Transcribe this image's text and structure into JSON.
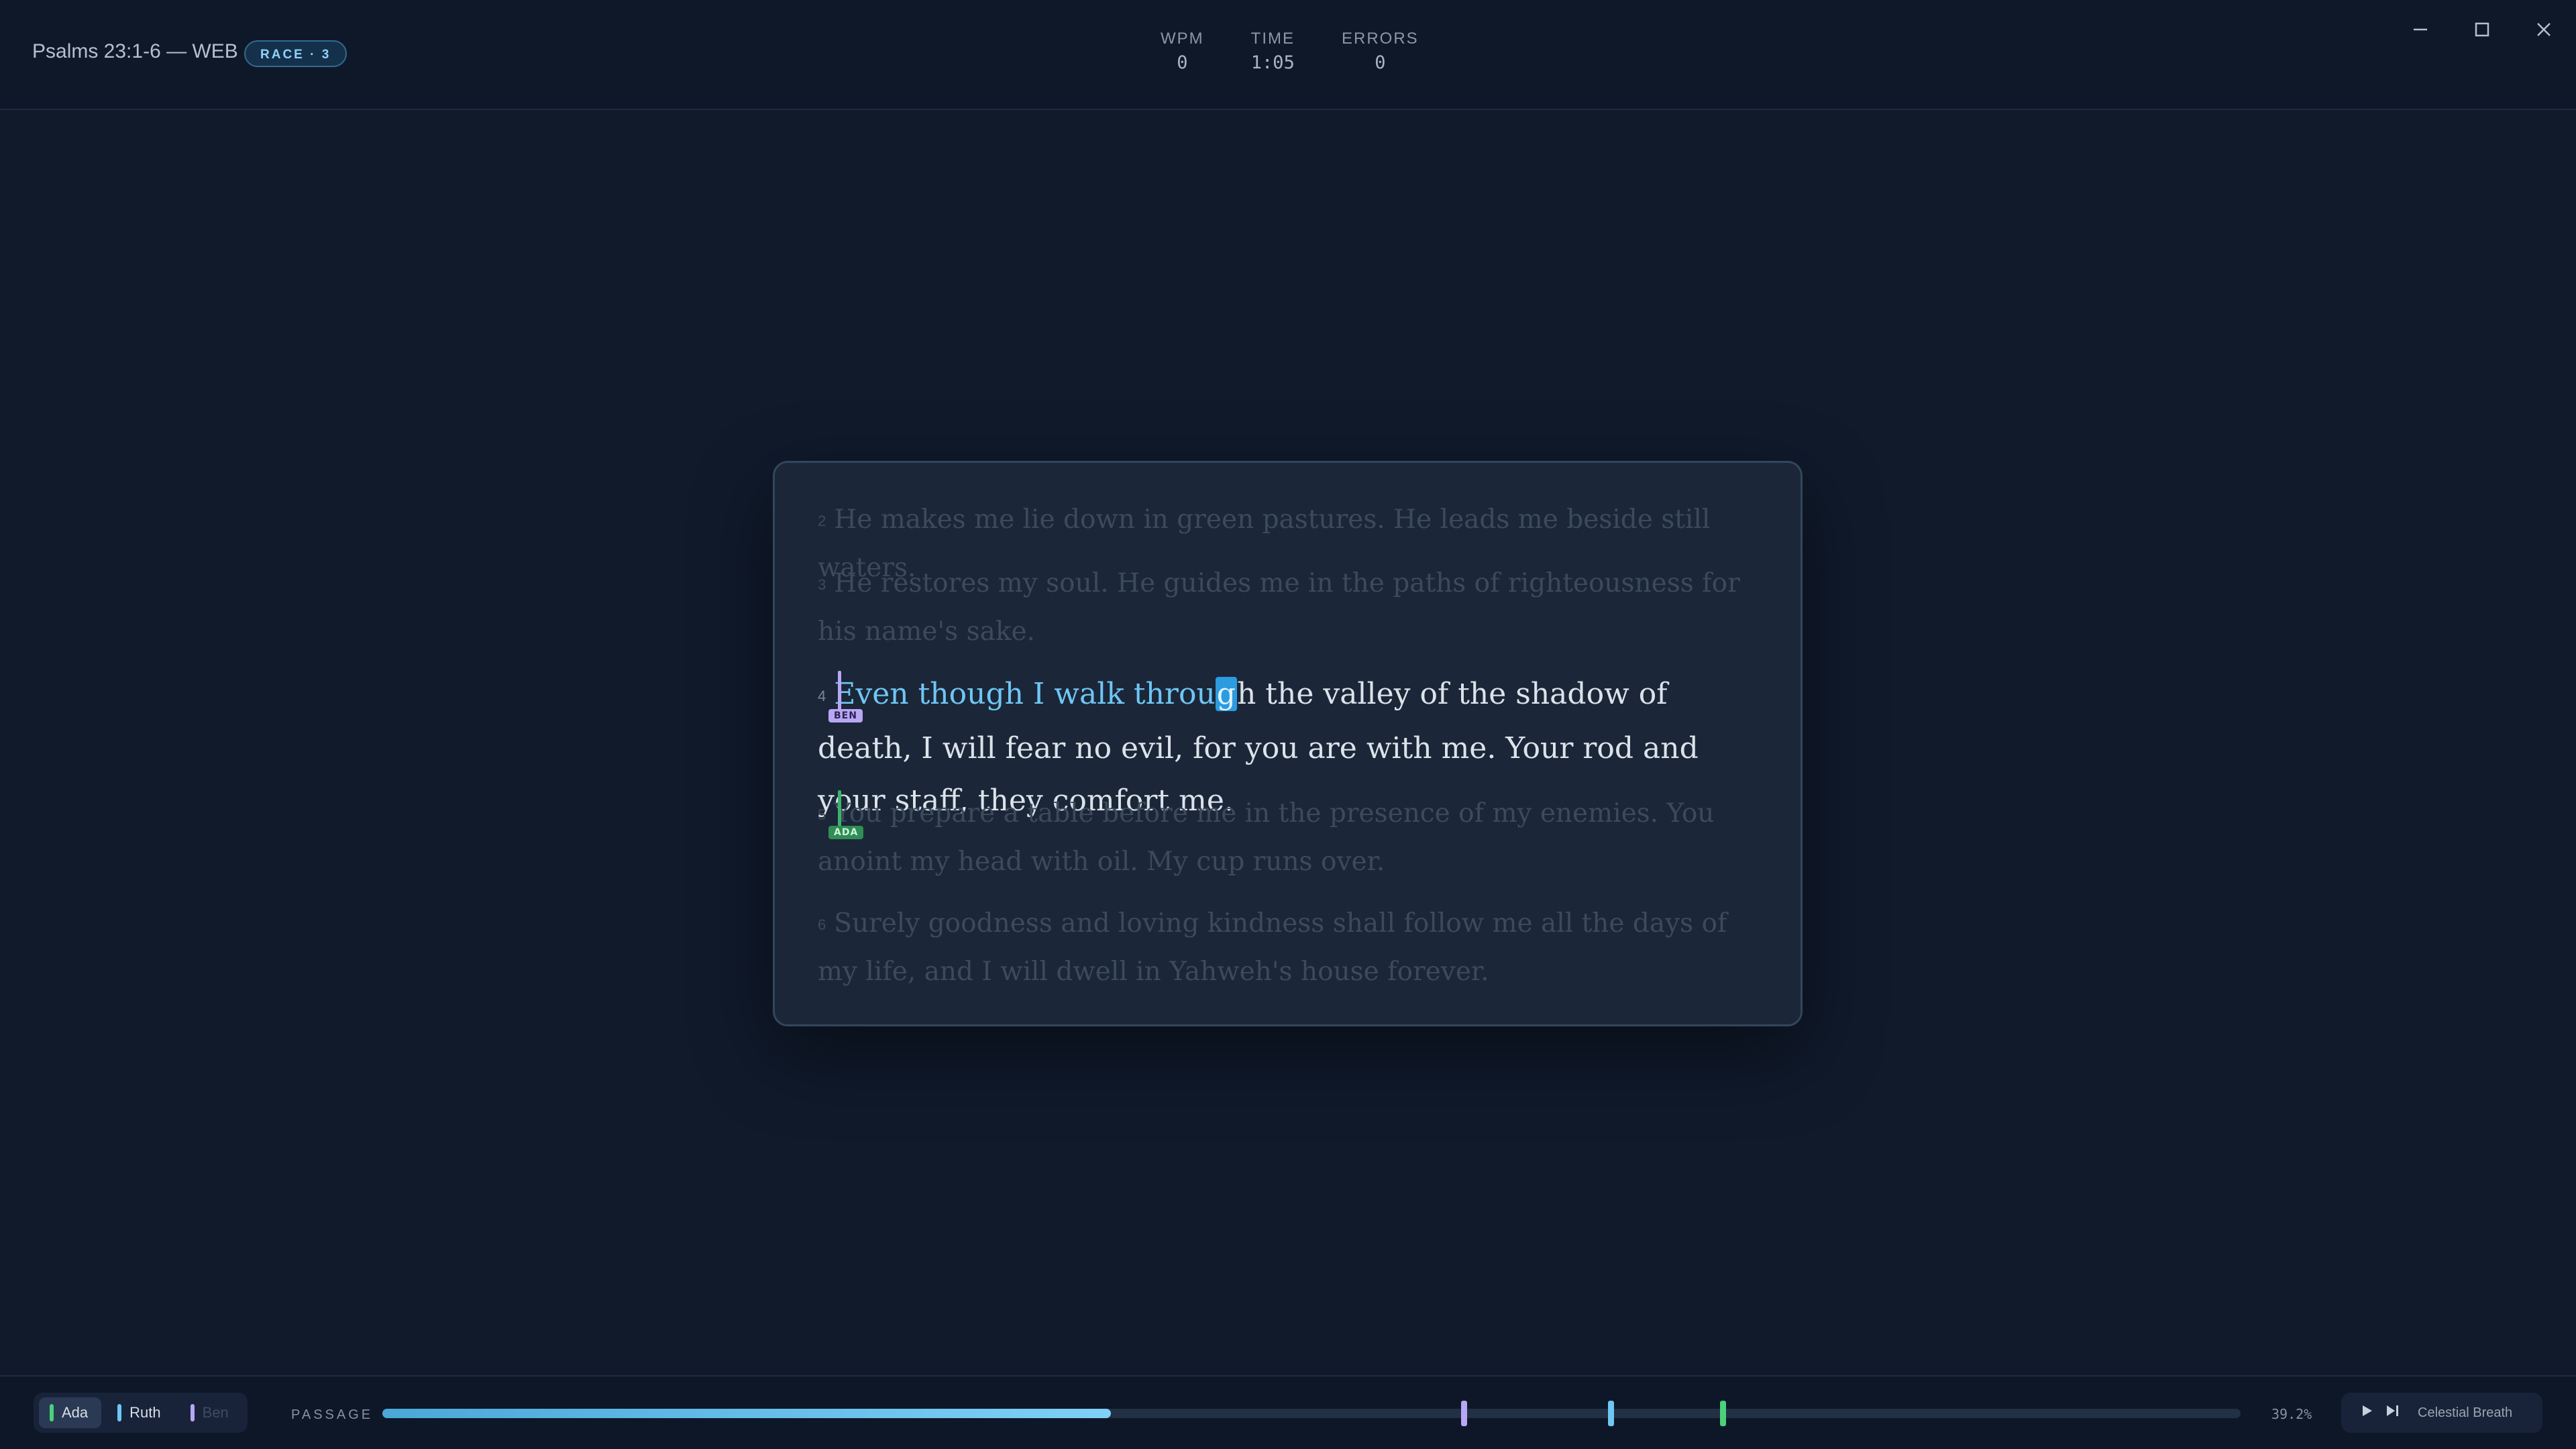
{
  "header": {
    "passage_title": "Psalms 23:1-6 — WEB",
    "race_badge": "RACE · 3",
    "stats": [
      {
        "label": "WPM",
        "value": "0"
      },
      {
        "label": "TIME",
        "value": "1:05"
      },
      {
        "label": "ERRORS",
        "value": "0"
      }
    ]
  },
  "passage": {
    "verses": [
      {
        "num": "2",
        "text": "He makes me lie down in green pastures. He leads me beside still waters."
      },
      {
        "num": "3",
        "text": "He restores my soul. He guides me in the paths of righteousness for his name's sake."
      },
      {
        "num": "4",
        "typed": "Even though I walk throu",
        "cursor": "g",
        "rest": "h the valley of the shadow of death, I will fear no evil, for you are with me. Your rod and your staff, they comfort me."
      },
      {
        "num": "5",
        "text": "You prepare a table before me in the presence of my enemies. You anoint my head with oil. My cup runs over."
      },
      {
        "num": "6",
        "text": "Surely goodness and loving kindness shall follow me all the days of my life, and I will dwell in Yahweh's house forever."
      }
    ],
    "tags": {
      "ben": "BEN",
      "ada": "ADA"
    }
  },
  "footer": {
    "racers": [
      {
        "name": "Ada",
        "color": "#4cd07a"
      },
      {
        "name": "Ruth",
        "color": "#6fc6f4"
      },
      {
        "name": "Ben",
        "color": "#b9a6f5"
      }
    ],
    "passage_label": "PASSAGE",
    "progress": 0.392,
    "percent": "39.2%",
    "track_name": "Celestial Breath"
  },
  "colors": {
    "ada": "#4cd07a",
    "ruth": "#6fc6f4",
    "ben": "#b9a6f5"
  }
}
